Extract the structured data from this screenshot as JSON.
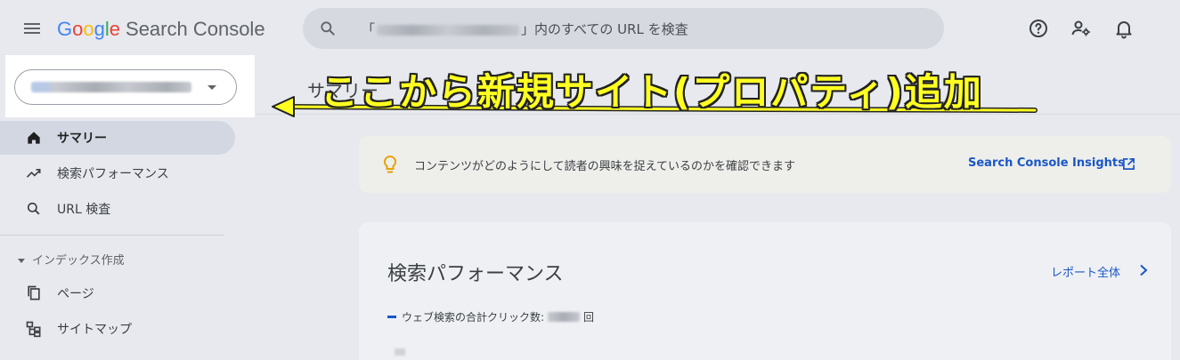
{
  "header": {
    "app_title": "Search Console",
    "logo_letters": [
      "G",
      "o",
      "o",
      "g",
      "l",
      "e"
    ],
    "search_prefix": "「",
    "search_suffix": "」内のすべての URL を検査",
    "icons": [
      "menu-icon",
      "search-icon",
      "help-icon",
      "manage-users-icon",
      "bell-icon"
    ]
  },
  "sidebar": {
    "property_selector": {
      "value_redacted": true
    },
    "items": [
      {
        "label": "サマリー",
        "icon": "home-icon",
        "active": true
      },
      {
        "label": "検索パフォーマンス",
        "icon": "trending-up-icon",
        "active": false
      },
      {
        "label": "URL 検査",
        "icon": "search-icon",
        "active": false
      }
    ],
    "section": {
      "label": "インデックス作成"
    },
    "section_items": [
      {
        "label": "ページ",
        "icon": "pages-icon"
      },
      {
        "label": "サイトマップ",
        "icon": "sitemap-icon"
      }
    ]
  },
  "main": {
    "page_title": "サマリー",
    "insights": {
      "text": "コンテンツがどのようにして読者の興味を捉えているのかを確認できます",
      "link": "Search Console Insights"
    },
    "performance": {
      "title": "検索パフォーマンス",
      "report_link": "レポート全体",
      "legend_label": "ウェブ検索の合計クリック数:",
      "legend_unit": "回"
    }
  },
  "annotation": {
    "text": "ここから新規サイト(プロパティ)追加",
    "color": "#ffff22"
  },
  "colors": {
    "accent": "#1a57c6",
    "active_nav": "#d2d7e2",
    "background": "#e7e9ee"
  }
}
